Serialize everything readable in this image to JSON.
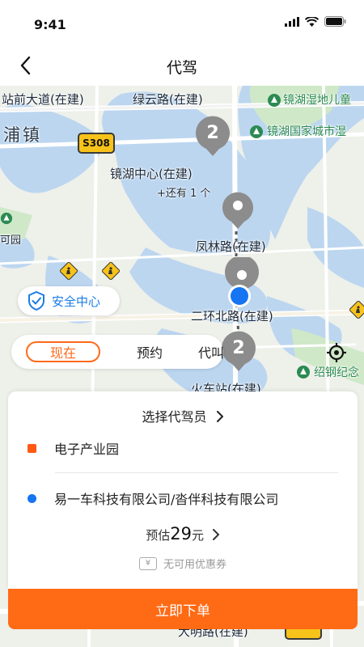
{
  "status": {
    "time": "9:41"
  },
  "header": {
    "title": "代驾"
  },
  "map": {
    "labels": {
      "station_avenue": "站前大道(在建)",
      "lvyun_road": "绿云路(在建)",
      "jinghu_wetland": "镜湖湿地儿童",
      "pu_town": "浦镇",
      "jinghu_park": "镜湖国家城市湿",
      "jinghu_center": "镜湖中心(在建)",
      "more": "+还有 1 个",
      "fenglin_road": "凤林路(在建)",
      "he_road": "可园",
      "second_ring_north": "二环北路(在建)",
      "train_station": "火车站(在建)",
      "shaoxing_memorial": "绍钢纪念",
      "daming_road": "大明路(在建)"
    },
    "road_badge": "S308",
    "cluster_top": "2",
    "cluster_bottom": "2",
    "colors": {
      "water": "#bcd6f0",
      "land": "#eef0ea",
      "green": "#cfe8c8",
      "pin": "#8c8c8c"
    }
  },
  "safety": {
    "label": "安全中心"
  },
  "modes": {
    "now": "现在",
    "reserve": "预约",
    "call": "代叫"
  },
  "card": {
    "select_driver": "选择代驾员",
    "start": "电子产业园",
    "end": "易一车科技有限公司/沓伴科技有限公司",
    "estimate_prefix": "预估",
    "estimate_price": "29",
    "estimate_unit": "元",
    "coupon": "无可用优惠券",
    "coupon_symbol": "¥"
  },
  "action": {
    "order": "立即下单"
  },
  "colors": {
    "accent": "#ff6a14",
    "blue": "#1575f2"
  }
}
